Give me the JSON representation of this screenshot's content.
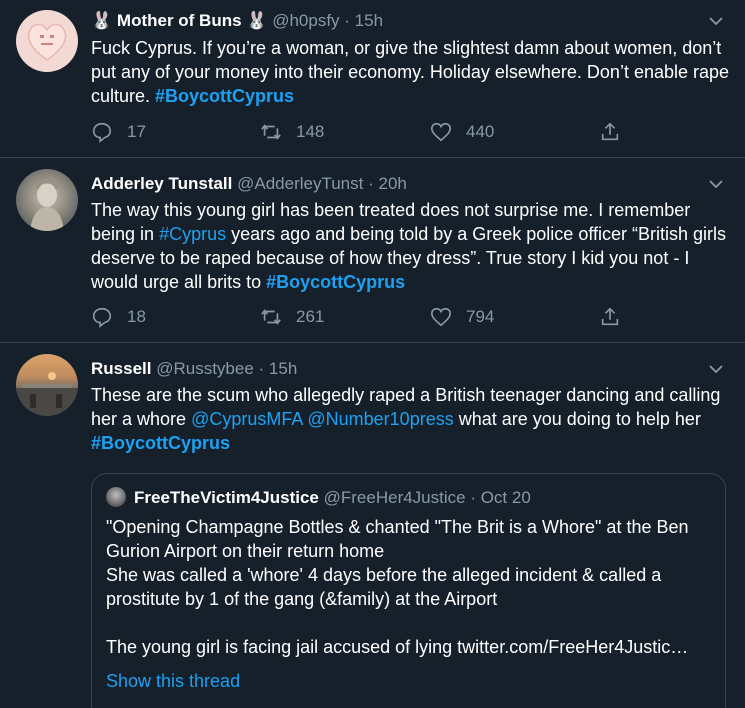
{
  "tweets": [
    {
      "name": "Mother of Buns",
      "name_emoji": "🐰",
      "handle": "@h0psfy",
      "time": "· 15h",
      "text": "Fuck Cyprus. If you’re a woman, or give the slightest damn about women, don’t put any of your money into their economy. Holiday elsewhere. Don’t enable rape culture. ",
      "hashtag": "#BoycottCyprus",
      "replies": "17",
      "retweets": "148",
      "likes": "440"
    },
    {
      "name": "Adderley Tunstall",
      "handle": "@AdderleyTunst",
      "time": "· 20h",
      "text_part1": "The way this young girl has been treated does not surprise me.  I remember being in ",
      "inline_hashtag": "#Cyprus",
      "text_part2": " years ago and being told by a Greek police officer “British girls deserve to be raped because of how they dress”. True story I kid you not - I would urge all brits to ",
      "hashtag": "#BoycottCyprus",
      "replies": "18",
      "retweets": "261",
      "likes": "794"
    },
    {
      "name": "Russell",
      "handle": "@Russtybee",
      "time": "· 15h",
      "text_part1": "These are the scum who allegedly raped a British teenager dancing and calling her a whore ",
      "mention1": "@CyprusMFA",
      "mention2": "@Number10press",
      "text_part2": " what are you doing to help her ",
      "hashtag": "#BoycottCyprus",
      "quote": {
        "name": "FreeTheVictim4Justice",
        "handle": "@FreeHer4Justice",
        "time": "· Oct 20",
        "text": "\"Opening Champagne Bottles & chanted \"The Brit is a Whore\" at the Ben Gurion Airport on their return home\nShe was called a 'whore' 4 days before the alleged incident & called a prostitute by 1 of the gang (&family) at the Airport\n\nThe young girl is facing jail accused of lying twitter.com/FreeHer4Justic…",
        "show_thread": "Show this thread"
      }
    }
  ],
  "colors": {
    "background": "#15202b",
    "divider": "#38444d",
    "secondary_text": "#8899a6",
    "link": "#1da1f2"
  },
  "icons": {
    "reply": "reply-icon",
    "retweet": "retweet-icon",
    "like": "heart-icon",
    "share": "share-icon",
    "more": "chevron-down-icon"
  }
}
